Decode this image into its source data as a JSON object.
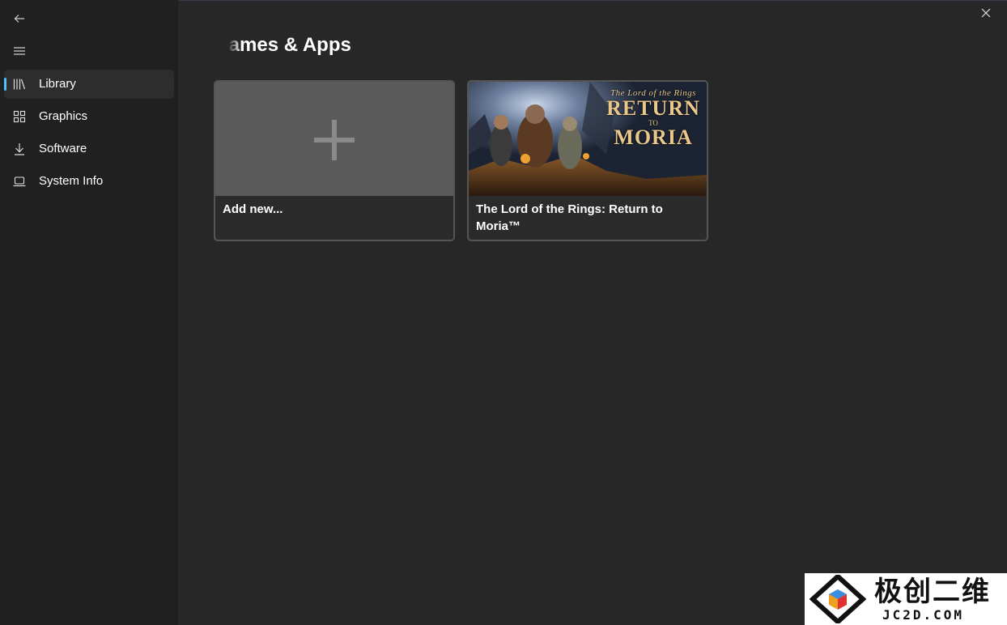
{
  "window": {
    "back_icon": "arrow-left-icon",
    "menu_icon": "hamburger-menu-icon",
    "close_icon": "close-icon"
  },
  "sidebar": {
    "items": [
      {
        "label": "Library",
        "icon": "library-books-icon",
        "selected": true
      },
      {
        "label": "Graphics",
        "icon": "grid-apps-icon",
        "selected": false
      },
      {
        "label": "Software",
        "icon": "download-icon",
        "selected": false
      },
      {
        "label": "System Info",
        "icon": "laptop-icon",
        "selected": false
      }
    ],
    "accent_color": "#4cc2ff"
  },
  "main": {
    "title": "Games & Apps",
    "cards": [
      {
        "label": "Add new...",
        "icon": "plus-icon"
      },
      {
        "label": "The Lord of the Rings: Return to Moria™",
        "art": {
          "line1": "The Lord of the Rings",
          "line2": "RETURN",
          "line3": "TO",
          "line4": "MORIA"
        }
      }
    ]
  },
  "watermark": {
    "text": "极创二维",
    "subtext": "JC2D.COM"
  }
}
